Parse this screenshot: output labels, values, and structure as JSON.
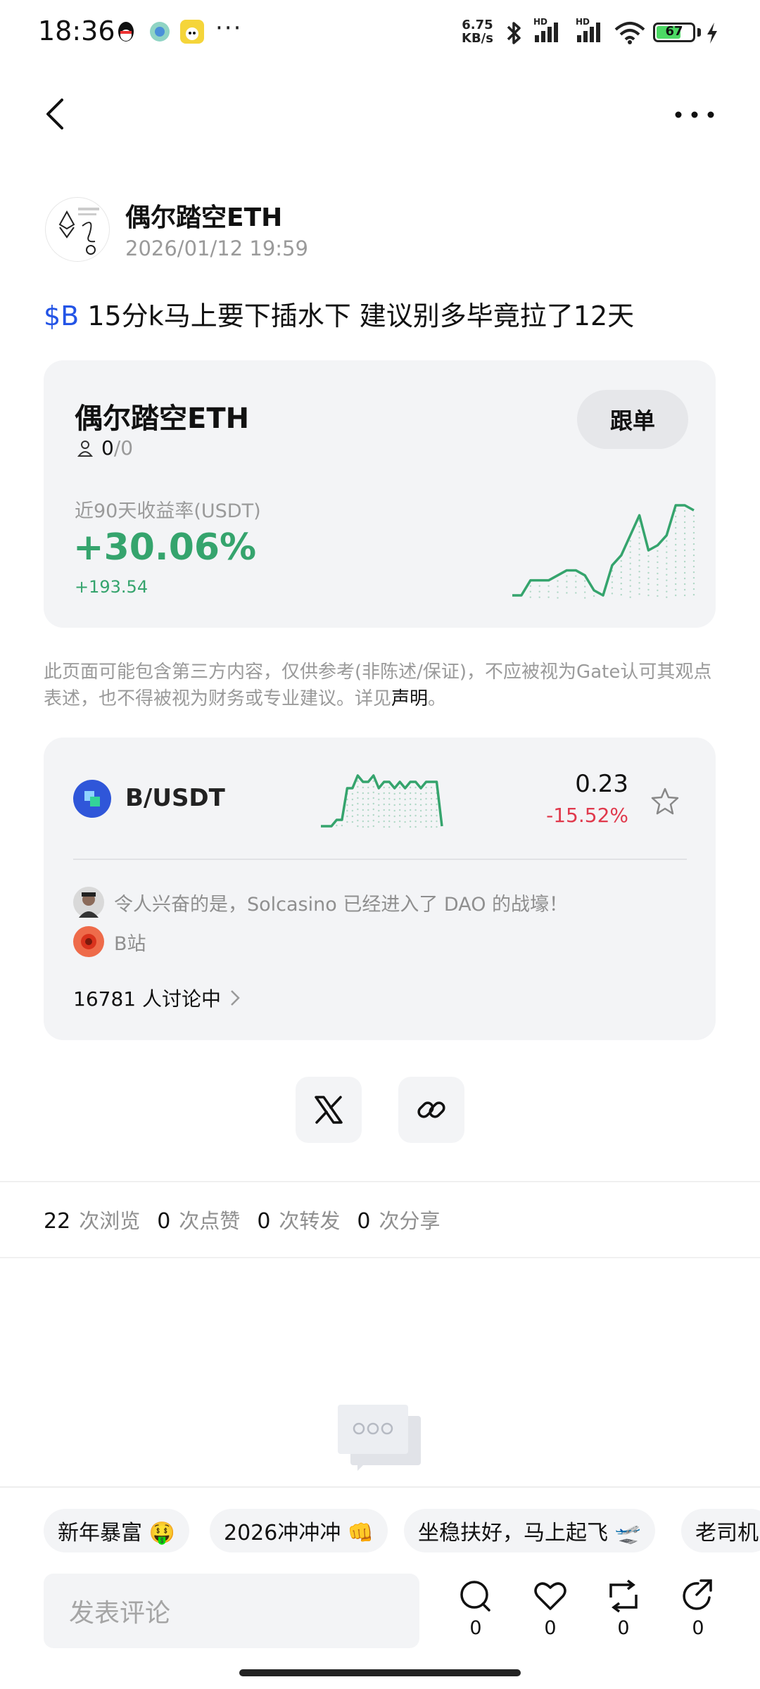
{
  "status_bar": {
    "time": "18:36",
    "more_dots": "···",
    "net_speed_value": "6.75",
    "net_speed_unit": "KB/s",
    "signal_1_label": "HD",
    "signal_2_label": "HD",
    "battery_level": "67",
    "icons": [
      "qq-icon",
      "browser-icon",
      "app-icon",
      "bluetooth-icon",
      "signal-icon",
      "wifi-icon",
      "battery-icon",
      "charging-icon"
    ]
  },
  "nav": {
    "back_icon": "chevron-left-icon",
    "more_icon": "more-horizontal-icon"
  },
  "post": {
    "author": "偶尔踏空ETH",
    "time": "2026/01/12 19:59",
    "tag": "$B",
    "text": " 15分k马上要下插水下 建议别多毕竟拉了12天"
  },
  "trader_card": {
    "name": "偶尔踏空ETH",
    "followers_current": "0",
    "followers_separator": "/",
    "followers_max": "0",
    "follow_button": "跟单",
    "roi_label": "近90天收益率(USDT)",
    "roi_value": "+30.06%",
    "roi_absolute": "+193.54",
    "sparkline": [
      0,
      0,
      3,
      3,
      3,
      4,
      5,
      5,
      4,
      1,
      0,
      6,
      8,
      12,
      16,
      9,
      10,
      12,
      18,
      18,
      17
    ],
    "color": "#35a46d"
  },
  "disclaimer": {
    "text": "此页面可能包含第三方内容，仅供参考(非陈述/保证)，不应被视为Gate认可其观点表述，也不得被视为财务或专业建议。详见",
    "link": "声明",
    "end": "。"
  },
  "market_card": {
    "pair": "B/USDT",
    "price": "0.23",
    "change": "-15.52%",
    "change_color": "#e0394c",
    "sparkline": [
      2,
      2,
      2,
      3,
      3,
      8,
      8,
      10,
      9,
      9,
      10,
      8,
      9,
      9,
      8,
      9,
      8,
      9,
      9,
      8,
      9,
      9,
      9,
      2
    ],
    "news": [
      {
        "text": "令人兴奋的是，Solcasino 已经进入了 DAO 的战壕！"
      },
      {
        "text": "B站"
      }
    ],
    "discussion": "16781 人讨论中"
  },
  "share": {
    "x_icon": "x-logo-icon",
    "link_icon": "link-icon"
  },
  "stats": {
    "views": "22",
    "views_label": "次浏览",
    "likes": "0",
    "likes_label": "次点赞",
    "reposts": "0",
    "reposts_label": "次转发",
    "shares": "0",
    "shares_label": "次分享"
  },
  "quick_tags": [
    "新年暴富 🤑",
    "2026冲冲冲 👊",
    "坐稳扶好，马上起飞 🛫",
    "老司机"
  ],
  "comment": {
    "placeholder": "发表评论"
  },
  "actions": {
    "comment_count": "0",
    "like_count": "0",
    "repost_count": "0",
    "share_count": "0"
  }
}
